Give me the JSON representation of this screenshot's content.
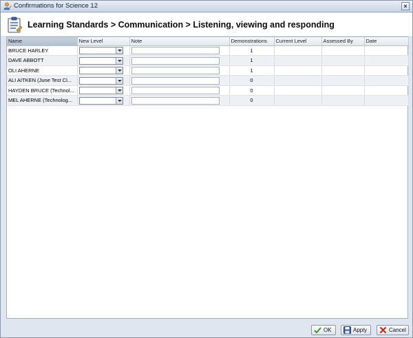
{
  "window": {
    "title": "Confirmations for Science 12",
    "close_glyph": "×"
  },
  "header": {
    "title": "Learning Standards > Communication > Listening, viewing and responding"
  },
  "grid": {
    "columns": [
      "Name",
      "New Level",
      "Note",
      "Demonstrations",
      "Current Level",
      "Assessed By",
      "Date"
    ],
    "rows": [
      {
        "name": "BRUCE HARLEY",
        "demonstrations": "1"
      },
      {
        "name": "DAVE ABBOTT",
        "demonstrations": "1"
      },
      {
        "name": "OLI AHERNE",
        "demonstrations": "1"
      },
      {
        "name": "ALI AITKEN (June Test Cl...",
        "demonstrations": "0"
      },
      {
        "name": "HAYDEN BRUCE (Technol...",
        "demonstrations": "0"
      },
      {
        "name": "MEL AHERNE (Technolog...",
        "demonstrations": "0"
      }
    ]
  },
  "footer": {
    "ok_label": "OK",
    "apply_label": "Apply",
    "cancel_label": "Cancel"
  },
  "icons": {
    "title": "user-edit-icon",
    "header": "clipboard-list-icon",
    "ok": "check-icon",
    "apply": "save-icon",
    "cancel": "x-icon"
  },
  "colors": {
    "ok_check": "#3a9a2a",
    "cancel_x": "#c8251b",
    "apply_disk": "#3b5fa8"
  }
}
